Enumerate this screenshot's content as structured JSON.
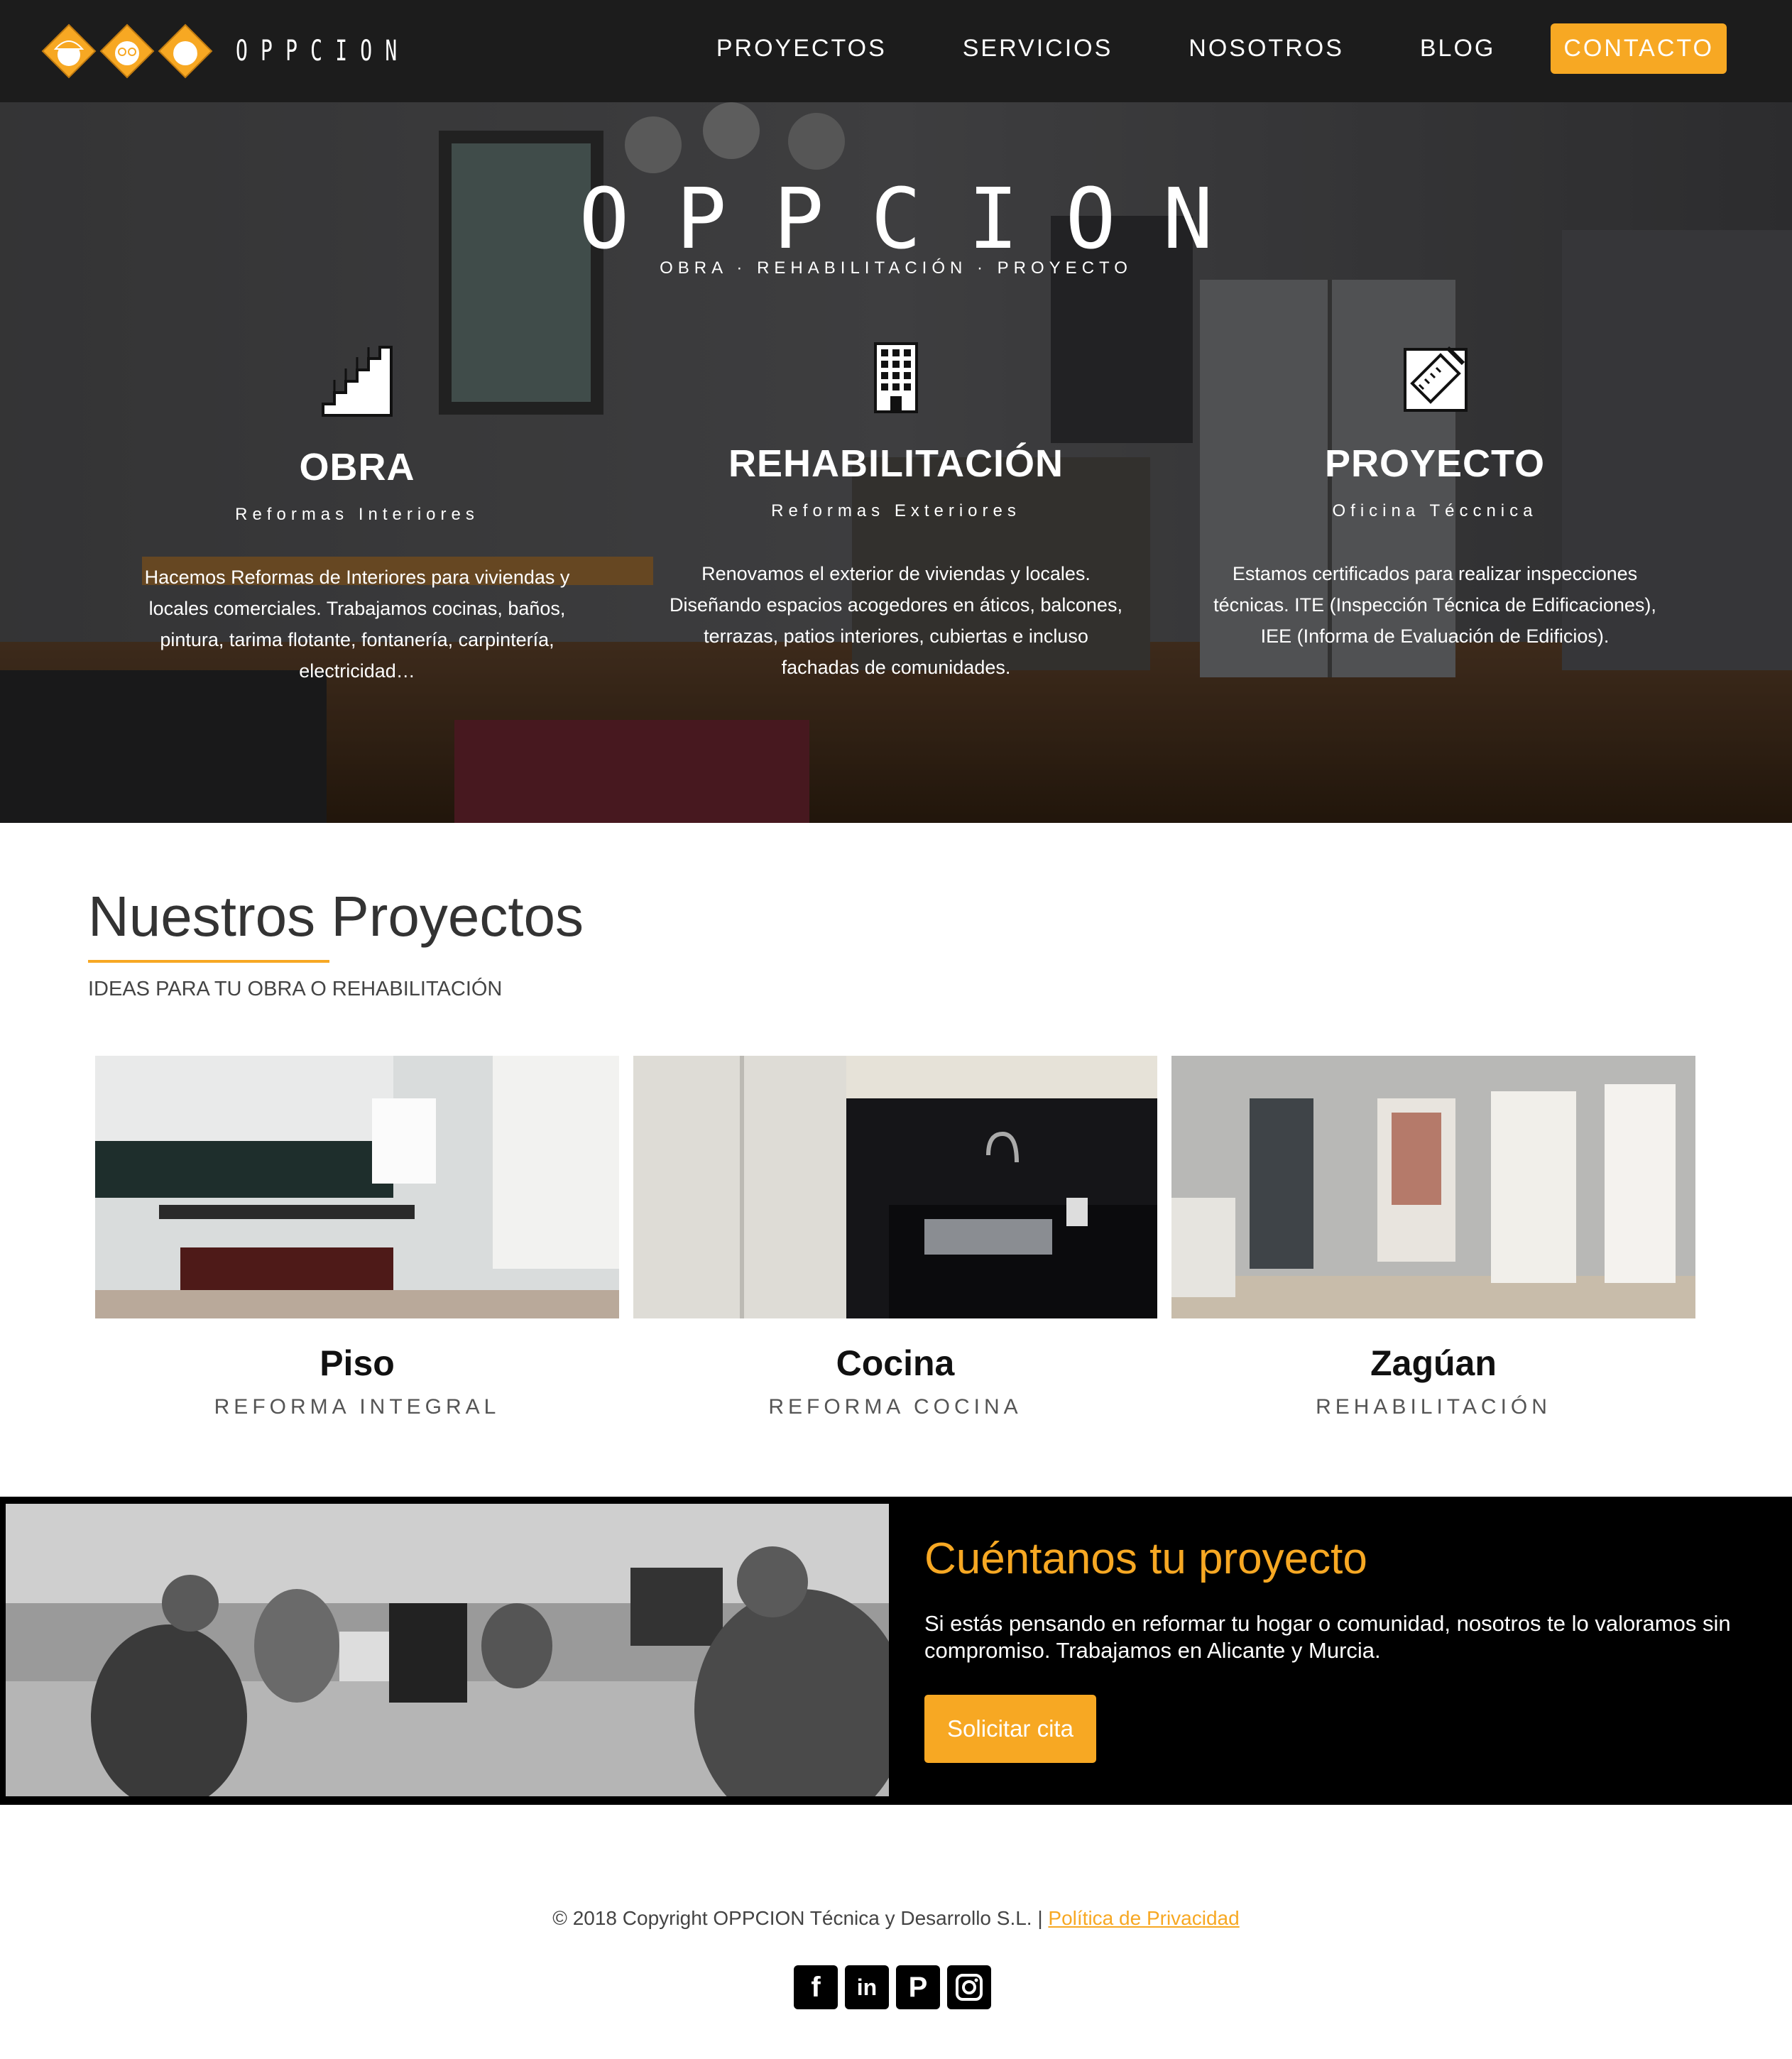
{
  "nav": {
    "logo_text": "OPPCION",
    "items": [
      {
        "label": "PROYECTOS"
      },
      {
        "label": "SERVICIOS"
      },
      {
        "label": "NOSOTROS"
      },
      {
        "label": "BLOG"
      }
    ],
    "cta_label": "CONTACTO"
  },
  "hero": {
    "brand": "OPPCION",
    "tagline": "OBRA · REHABILITACIÓN · PROYECTO",
    "services": [
      {
        "title": "OBRA",
        "subtitle": "Reformas Interiores",
        "text": "Hacemos Reformas de Interiores para viviendas y locales comerciales. Trabajamos cocinas, baños, pintura, tarima flotante, fontanería, carpintería, electricidad…",
        "icon": "stairs-icon"
      },
      {
        "title": "REHABILITACIÓN",
        "subtitle": "Reformas Exteriores",
        "text": "Renovamos el exterior de viviendas y locales. Diseñando espacios acogedores en áticos, balcones, terrazas, patios interiores, cubiertas e incluso fachadas de comunidades.",
        "icon": "building-icon"
      },
      {
        "title": "PROYECTO",
        "subtitle": "Oficina Téccnica",
        "text": "Estamos certificados para realizar inspecciones técnicas. ITE (Inspección Técnica de Edificaciones), IEE (Informa de Evaluación de Edificios).",
        "icon": "blueprint-icon"
      }
    ]
  },
  "projects": {
    "title": "Nuestros Proyectos",
    "subtitle": "IDEAS PARA TU OBRA O REHABILITACIÓN",
    "cards": [
      {
        "title": "Piso",
        "caption": "REFORMA INTEGRAL"
      },
      {
        "title": "Cocina",
        "caption": "REFORMA COCINA"
      },
      {
        "title": "Zagúan",
        "caption": "REHABILITACIÓN"
      }
    ]
  },
  "cta": {
    "title": "Cuéntanos tu proyecto",
    "text": "Si estás pensando en reformar tu hogar o comunidad, nosotros te lo valoramos sin compromiso. Trabajamos en Alicante y Murcia.",
    "button": "Solicitar cita"
  },
  "footer": {
    "copyright": "© 2018 Copyright OPPCION Técnica y Desarrollo S.L. | ",
    "privacy": "Política de Privacidad",
    "social": [
      "facebook-icon",
      "linkedin-icon",
      "pinterest-icon",
      "instagram-icon"
    ]
  },
  "colors": {
    "accent": "#f7a823",
    "nav_bg": "#1c1c1c",
    "cta_bg": "#000000"
  }
}
